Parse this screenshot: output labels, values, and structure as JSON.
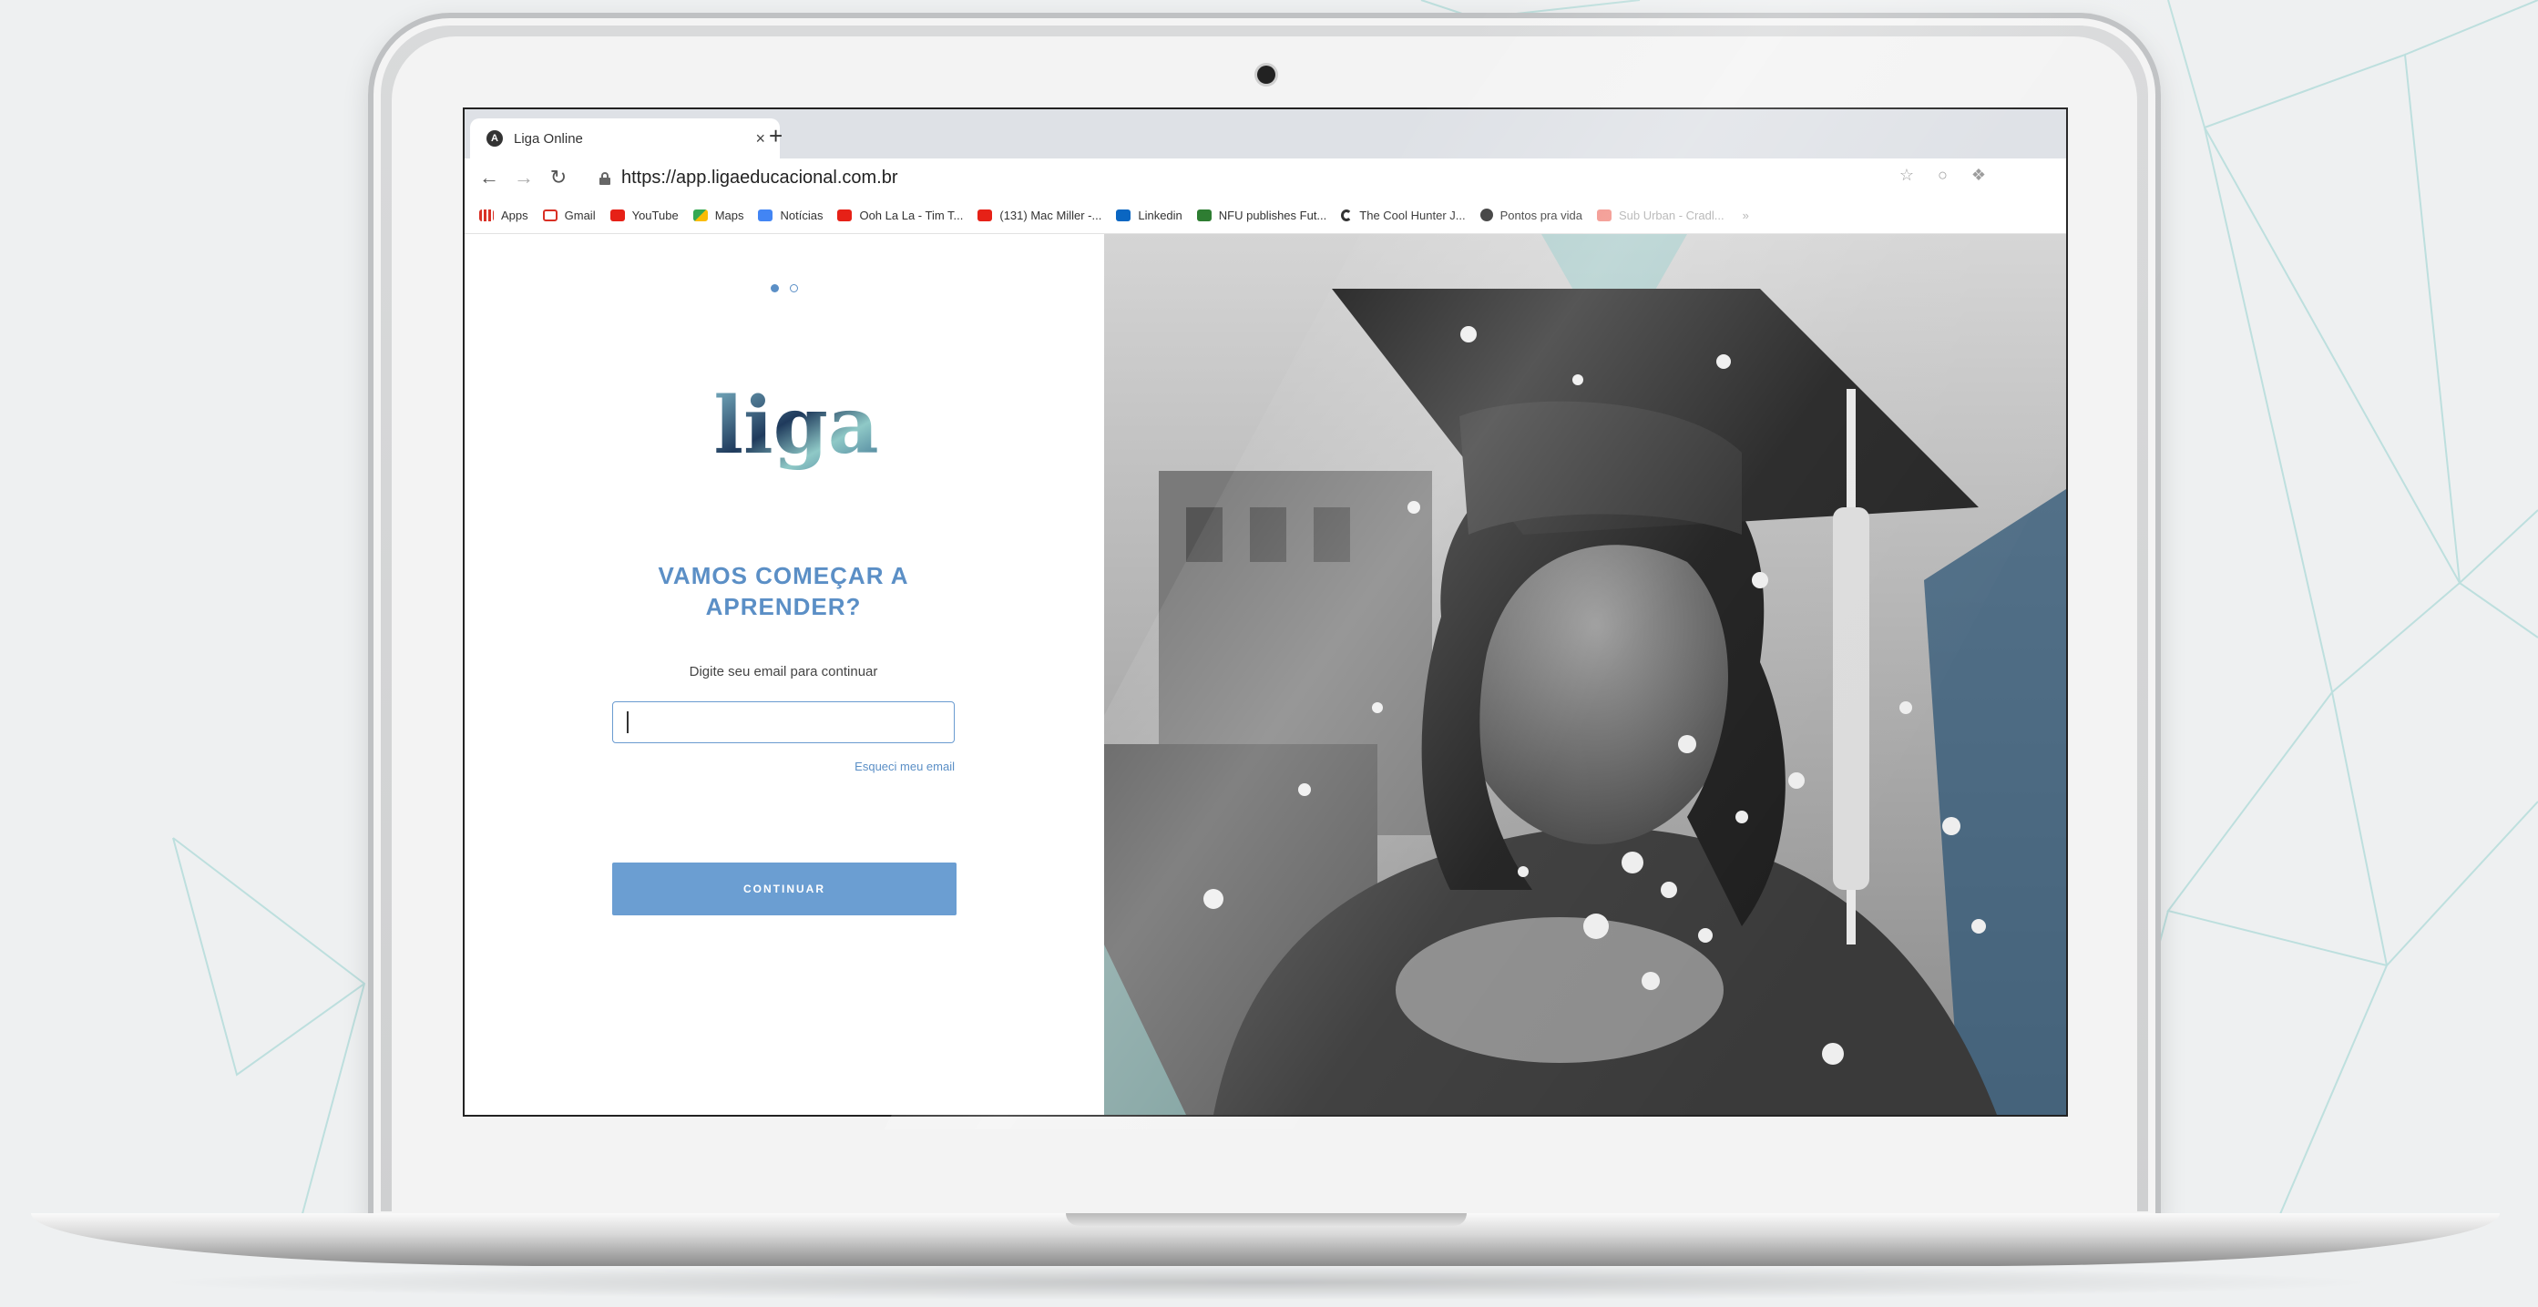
{
  "browser": {
    "tab_title": "Liga Online",
    "tab_close": "×",
    "new_tab": "+",
    "url": "https://app.ligaeducacional.com.br",
    "bookmarks": [
      {
        "label": "Apps",
        "icon": "apps-grid-icon",
        "color": "#d93025"
      },
      {
        "label": "Gmail",
        "icon": "gmail-icon",
        "color": "#d93025"
      },
      {
        "label": "YouTube",
        "icon": "youtube-icon",
        "color": "#e62117"
      },
      {
        "label": "Maps",
        "icon": "maps-icon",
        "color": "#34a853"
      },
      {
        "label": "Notícias",
        "icon": "news-icon",
        "color": "#4285f4"
      },
      {
        "label": "Ooh La La - Tim T...",
        "icon": "youtube-icon",
        "color": "#e62117"
      },
      {
        "label": "(131) Mac Miller -...",
        "icon": "youtube-icon",
        "color": "#e62117"
      },
      {
        "label": "Linkedin",
        "icon": "linkedin-icon",
        "color": "#0a66c2"
      },
      {
        "label": "NFU publishes Fut...",
        "icon": "nfu-icon",
        "color": "#2e7d32"
      },
      {
        "label": "The Cool Hunter J...",
        "icon": "cool-hunter-icon",
        "color": "#333333"
      },
      {
        "label": "Pontos pra vida",
        "icon": "globe-icon",
        "color": "#333333"
      },
      {
        "label": "Sub Urban - Cradl...",
        "icon": "youtube-icon",
        "color": "#e62117"
      }
    ],
    "more_bookmarks": "»"
  },
  "login": {
    "logo_text": "liga",
    "heading_line1": "VAMOS COMEÇAR A",
    "heading_line2": "APRENDER?",
    "email_hint": "Digite seu email para continuar",
    "email_value": "",
    "forgot_email": "Esqueci meu email",
    "continue_label": "CONTINUAR"
  },
  "colors": {
    "accent": "#5b8fc6",
    "button": "#6b9ed2",
    "teal": "#8fc9c7",
    "navy": "#1f3a5c"
  }
}
